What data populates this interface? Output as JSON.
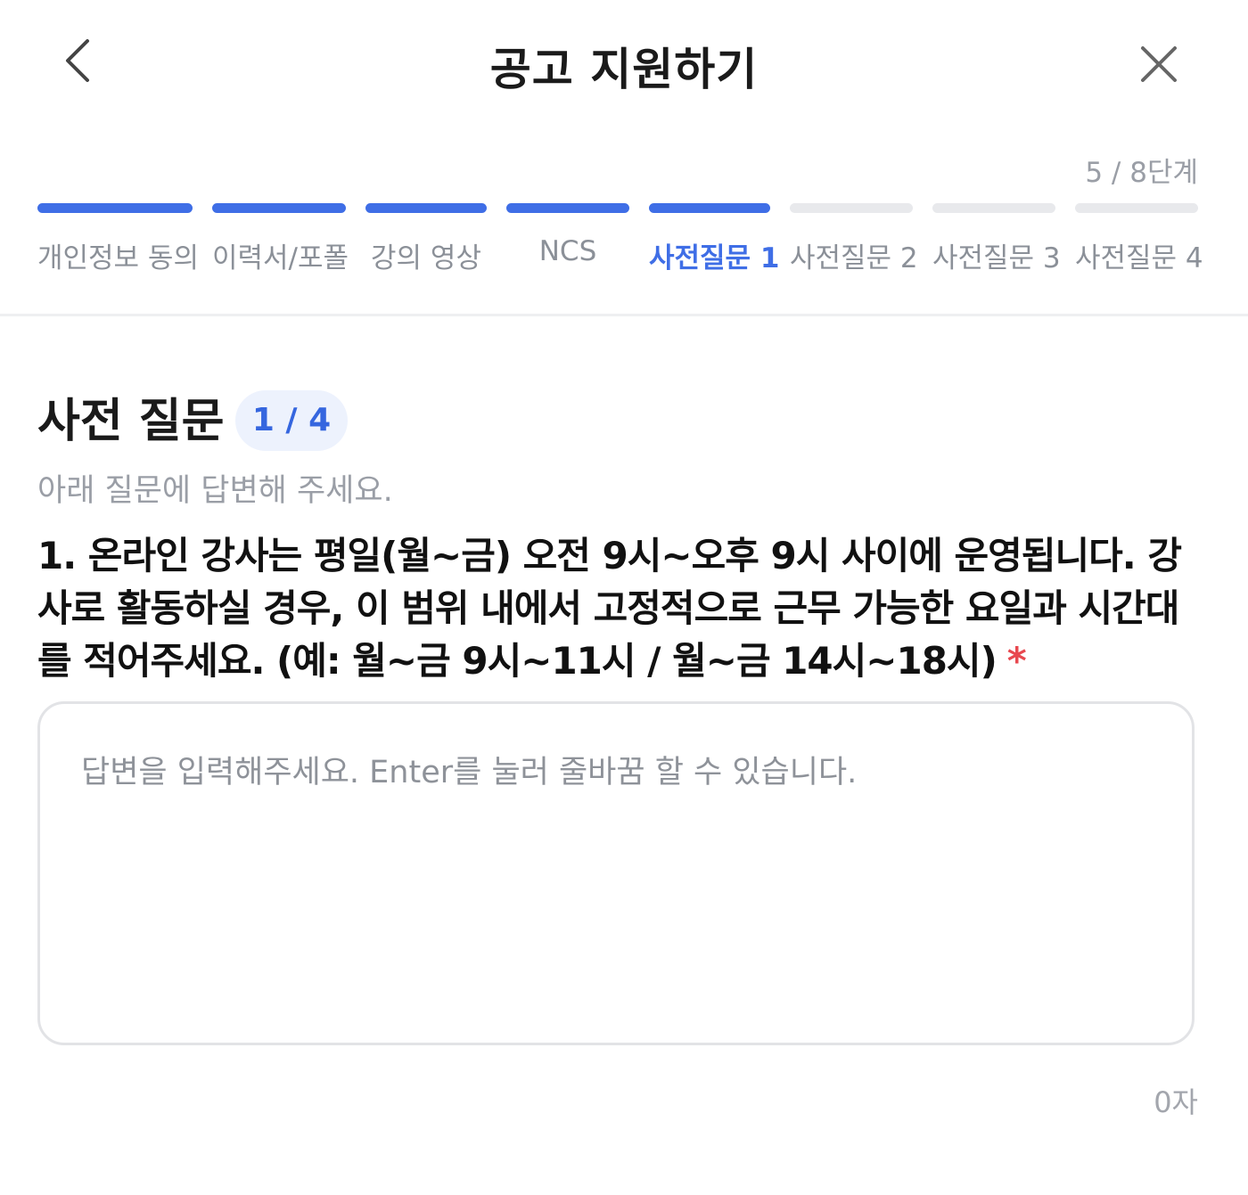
{
  "header": {
    "title": "공고 지원하기"
  },
  "progress": {
    "step_count": "5 / 8단계",
    "current_step": 5,
    "total_steps": 8,
    "active_color": "#3f6ee6",
    "steps": [
      {
        "label": "개인정보 동의"
      },
      {
        "label": "이력서/포폴"
      },
      {
        "label": "강의 영상"
      },
      {
        "label": "NCS"
      },
      {
        "label": "사전질문 1"
      },
      {
        "label": "사전질문 2"
      },
      {
        "label": "사전질문 3"
      },
      {
        "label": "사전질문 4"
      }
    ]
  },
  "section": {
    "title": "사전 질문",
    "counter": "1 / 4",
    "subtitle": "아래 질문에 답변해 주세요."
  },
  "question": {
    "text": "1. 온라인 강사는 평일(월~금) 오전 9시~오후 9시 사이에 운영됩니다. 강사로 활동하실 경우, 이 범위 내에서 고정적으로 근무 가능한 요일과 시간대를 적어주세요. (예: 월~금 9시~11시 / 월~금 14시~18시)",
    "required_mark": "*"
  },
  "answer": {
    "value": "",
    "placeholder": "답변을 입력해주세요. Enter를 눌러 줄바꿈 할 수 있습니다.",
    "char_count": "0자"
  },
  "icons": {
    "back": "chevron-left-icon",
    "close": "close-icon"
  }
}
